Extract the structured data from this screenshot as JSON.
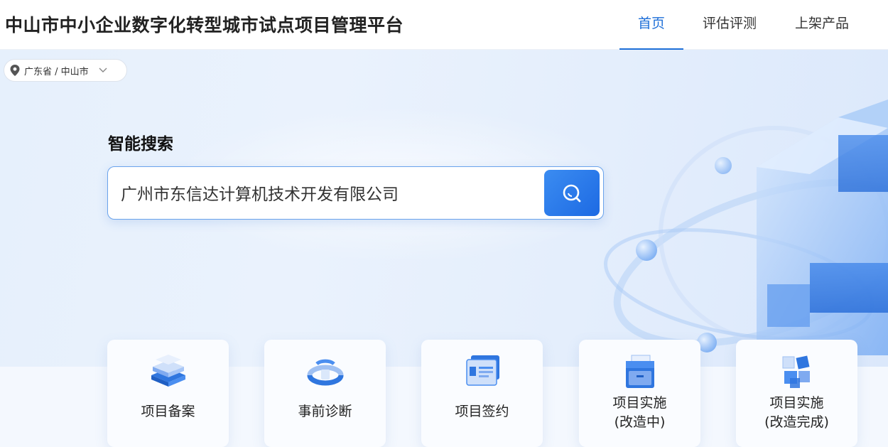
{
  "header": {
    "title": "中山市中小企业数字化转型城市试点项目管理平台",
    "nav": [
      {
        "label": "首页",
        "active": true
      },
      {
        "label": "评估评测",
        "active": false
      },
      {
        "label": "上架产品",
        "active": false
      }
    ]
  },
  "location": {
    "text": "广东省 / 中山市",
    "icon": "map-pin-icon"
  },
  "search": {
    "title": "智能搜索",
    "value": "广州市东信达计算机技术开发有限公司",
    "button_icon": "search-icon"
  },
  "cards": [
    {
      "label": "项目备案",
      "icon": "server-stack-icon"
    },
    {
      "label": "事前诊断",
      "icon": "diagnosis-ring-icon"
    },
    {
      "label": "项目签约",
      "icon": "contract-card-icon"
    },
    {
      "label_line1": "项目实施",
      "label_line2": "(改造中)",
      "icon": "file-cabinet-icon"
    },
    {
      "label_line1": "项目实施",
      "label_line2": "(改造完成)",
      "icon": "cubes-icon"
    }
  ],
  "colors": {
    "accent": "#1e6fd8",
    "search_button": "#2b7ae8",
    "hero_bg": "#e6f0fc"
  }
}
